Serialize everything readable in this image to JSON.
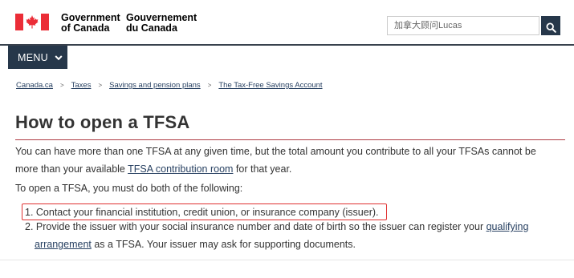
{
  "header": {
    "signature_en": [
      "Government",
      "of Canada"
    ],
    "signature_fr": [
      "Gouvernement",
      "du Canada"
    ],
    "search_placeholder": "加拿大顾问Lucas",
    "search_icon": "search-icon",
    "flag_icon": "canada-flag-icon"
  },
  "menu": {
    "label": "MENU",
    "icon": "chevron-down-icon"
  },
  "breadcrumb": {
    "items": [
      "Canada.ca",
      "Taxes",
      "Savings and pension plans",
      "The Tax-Free Savings Account"
    ],
    "separator": ">"
  },
  "main": {
    "title": "How to open a TFSA",
    "p1_before": "You can have more than one TFSA at any given time, but the total amount you contribute to all your TFSAs cannot be more than your available ",
    "p1_link": "TFSA contribution room",
    "p1_after": " for that year.",
    "p2": "To open a TFSA, you must do both of the following:",
    "steps": {
      "s1": "1. Contact your financial institution, credit union, or insurance company (issuer).",
      "s2_before": "2. Provide the issuer with your social insurance number and date of birth so the issuer can register your ",
      "s2_link_a": "qualifying",
      "s2_link_b": "arrangement",
      "s2_after": " as a TFSA. Your issuer may ask for supporting documents."
    }
  },
  "colors": {
    "brand_red": "#eb2d37",
    "navy": "#26374a",
    "link": "#284162",
    "title_rule": "#af3c43",
    "highlight": "#e03030"
  }
}
